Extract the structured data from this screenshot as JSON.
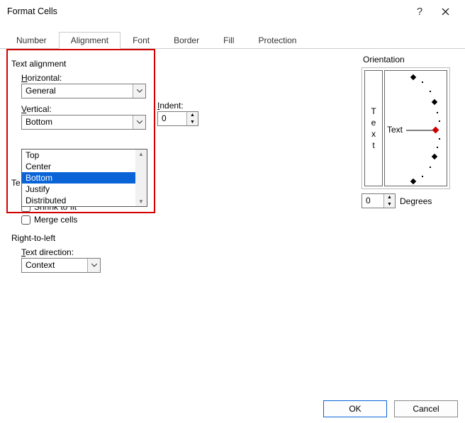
{
  "title": "Format Cells",
  "tabs": {
    "number": "Number",
    "alignment": "Alignment",
    "font": "Font",
    "border": "Border",
    "fill": "Fill",
    "protection": "Protection"
  },
  "text_alignment": {
    "header": "Text alignment",
    "horizontal_label_pre": "H",
    "horizontal_label_post": "orizontal:",
    "horizontal_value": "General",
    "vertical_label_pre": "V",
    "vertical_label_post": "ertical:",
    "vertical_value": "Bottom",
    "dropdown": {
      "top": "Top",
      "center": "Center",
      "bottom": "Bottom",
      "justify": "Justify",
      "distributed": "Distributed"
    },
    "indent_label_pre": "I",
    "indent_label_post": "ndent:",
    "indent_value": "0"
  },
  "text_control": {
    "header_fragment": "Te",
    "shrink_pre": "Shrin",
    "shrink_u": "k",
    "shrink_post": " to fit",
    "merge_pre": "M",
    "merge_post": "erge cells"
  },
  "rtl": {
    "header": "Right-to-left",
    "text_dir_pre": "T",
    "text_dir_post": "ext direction:",
    "text_dir_value": "Context"
  },
  "orientation": {
    "header": "Orientation",
    "vlabel_t": "T",
    "vlabel_e": "e",
    "vlabel_x": "x",
    "vlabel_t2": "t",
    "dial_text": "Text",
    "degrees_value": "0",
    "degrees_pre": "D",
    "degrees_post": "egrees"
  },
  "buttons": {
    "ok": "OK",
    "cancel": "Cancel"
  }
}
